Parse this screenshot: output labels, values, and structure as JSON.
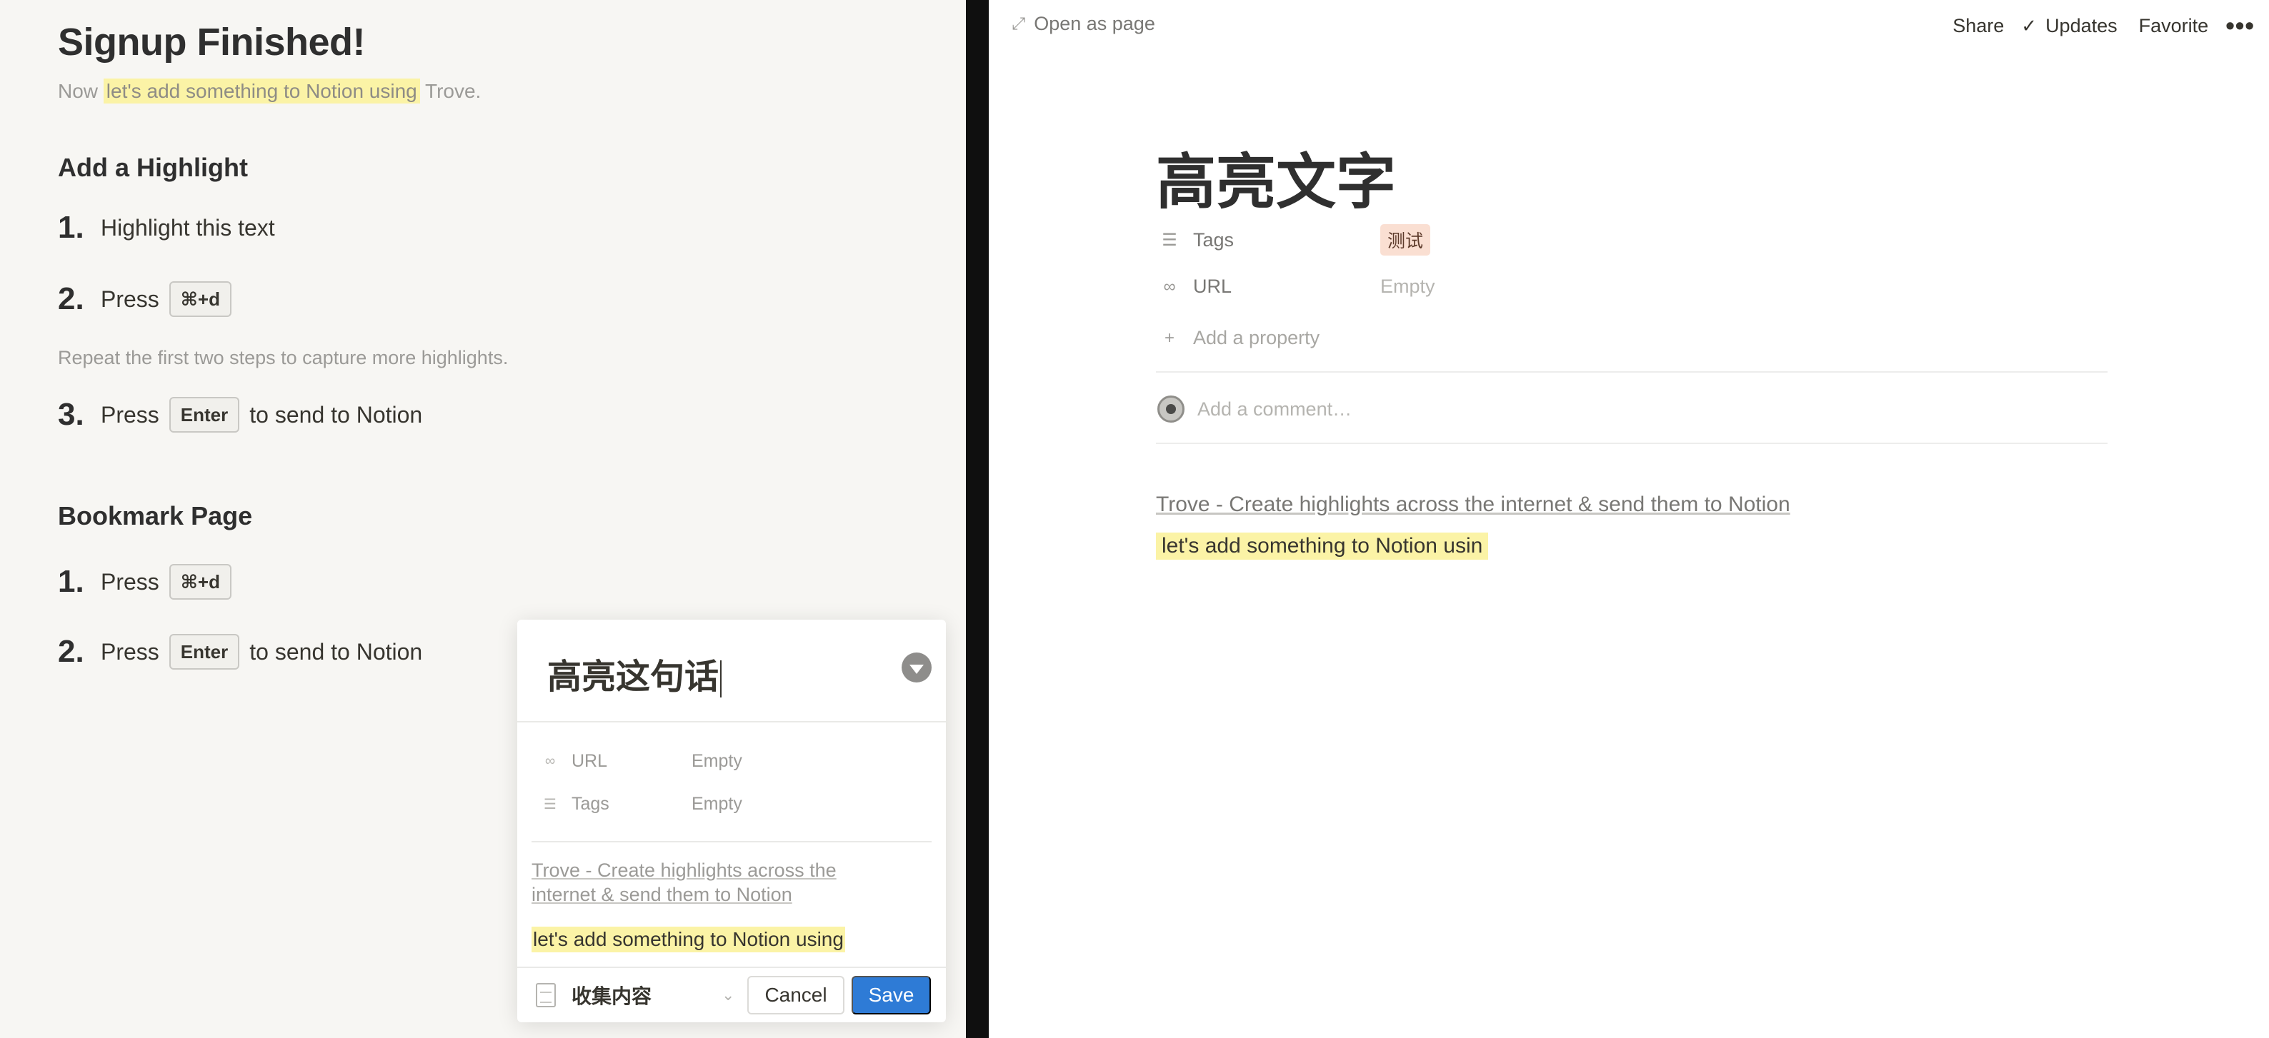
{
  "left": {
    "title": "Signup Finished!",
    "intro": {
      "before": "Now ",
      "highlight": "let's add something to Notion using",
      "after": " Trove."
    },
    "section1": {
      "heading": "Add a Highlight",
      "steps": [
        {
          "num": "1.",
          "text": "Highlight this text"
        },
        {
          "num": "2.",
          "text": "Press",
          "key": "⌘+d"
        }
      ],
      "hint": "Repeat the first two steps to capture more highlights.",
      "step3": {
        "num": "3.",
        "text": "Press",
        "key": "Enter",
        "after": "to send to Notion"
      }
    },
    "section2": {
      "heading": "Bookmark Page",
      "steps": [
        {
          "num": "1.",
          "text": "Press",
          "key": "⌘+d"
        },
        {
          "num": "2.",
          "text": "Press",
          "key": "Enter",
          "after": "to send to Notion"
        }
      ]
    }
  },
  "card": {
    "title": "高亮这句话",
    "props": [
      {
        "icon": "link-icon",
        "label": "URL",
        "value": "Empty"
      },
      {
        "icon": "list-icon",
        "label": "Tags",
        "value": "Empty"
      }
    ],
    "link_text": "Trove - Create highlights across the internet & send them to Notion",
    "highlight": "let's add something to Notion using",
    "footer": {
      "database": "收集内容",
      "cancel": "Cancel",
      "save": "Save"
    }
  },
  "right": {
    "topbar": {
      "open_as_page": "Open as page",
      "share": "Share",
      "updates": "Updates",
      "favorite": "Favorite",
      "more": "•••"
    },
    "page_title": "高亮文字",
    "props": [
      {
        "icon": "list-icon",
        "label": "Tags",
        "value": "测试"
      },
      {
        "icon": "link-icon",
        "label": "URL",
        "value": "Empty"
      }
    ],
    "add_property": "Add a property",
    "comment_placeholder": "Add a comment…",
    "link_text": "Trove - Create highlights across the internet & send them to Notion",
    "highlight": "let's add something to Notion usin"
  },
  "colors": {
    "highlight": "#fbf3a6",
    "tag_bg": "#fadfd2",
    "save_button": "#2e7bd6",
    "left_bg": "#f7f6f3",
    "divider": "#0f0f0f"
  }
}
